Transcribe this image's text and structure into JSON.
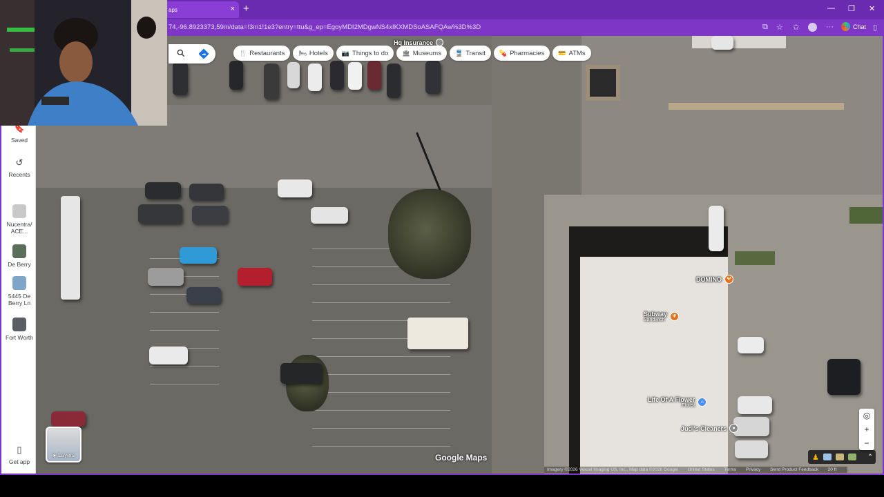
{
  "browser": {
    "tab_title": "aps",
    "tab_close": "×",
    "new_tab": "+",
    "url": "74,-96.8923373,59m/data=!3m1!1e3?entry=ttu&g_ep=EgoyMDI2MDgwNS4xIKXMDSoASAFQAw%3D%3D",
    "chat_label": "Chat",
    "window_controls": {
      "minimize": "—",
      "restore": "❐",
      "close": "✕"
    }
  },
  "search": {
    "search_icon": "search-icon",
    "directions_icon": "directions-icon"
  },
  "chips": [
    {
      "icon": "fork-knife-icon",
      "glyph": "🍴",
      "label": "Restaurants"
    },
    {
      "icon": "bed-icon",
      "glyph": "🛏",
      "label": "Hotels"
    },
    {
      "icon": "camera-icon",
      "glyph": "📷",
      "label": "Things to do"
    },
    {
      "icon": "museum-icon",
      "glyph": "🏛",
      "label": "Museums"
    },
    {
      "icon": "transit-icon",
      "glyph": "🚆",
      "label": "Transit"
    },
    {
      "icon": "pharmacy-icon",
      "glyph": "💊",
      "label": "Pharmacies"
    },
    {
      "icon": "atm-icon",
      "glyph": "💳",
      "label": "ATMs"
    }
  ],
  "sidebar": {
    "saved": "Saved",
    "recents": "Recents",
    "items": [
      {
        "label": "Nucentra/ ACE...",
        "thumb_color": "#c9c9c9"
      },
      {
        "label": "De Berry",
        "thumb_color": "#5a6f5a"
      },
      {
        "label": "5445 De Berry Ln",
        "thumb_color": "#7fa6c9"
      },
      {
        "label": "Fort Worth",
        "thumb_color": "#5a5f66"
      }
    ],
    "get_app": "Get app"
  },
  "map": {
    "pois": {
      "hq": "Hq Insurance",
      "domino": "DOMINO",
      "subway": "Subway",
      "subway_sub": "Sandwich",
      "flower": "Life Of A Flower",
      "flower_sub": "Florist",
      "cleaners": "Judi's Cleaners"
    },
    "layers_label": "Layers",
    "watermark": "Google Maps",
    "attribution": {
      "imagery": "Imagery ©2026 Vexcel Imaging US, Inc., Map data ©2026 Google",
      "country": "United States",
      "terms": "Terms",
      "privacy": "Privacy",
      "feedback": "Send Product Feedback",
      "scale": "20 ft"
    },
    "controls": {
      "locate": "◎",
      "zoom_in": "+",
      "zoom_out": "−"
    }
  },
  "colors": {
    "browser_purple": "#6b2bb0",
    "domino_pin": "#e8711a",
    "subway_pin": "#e8711a",
    "flower_pin": "#4a8df6",
    "cleaners_pin": "#8a8a8a"
  }
}
